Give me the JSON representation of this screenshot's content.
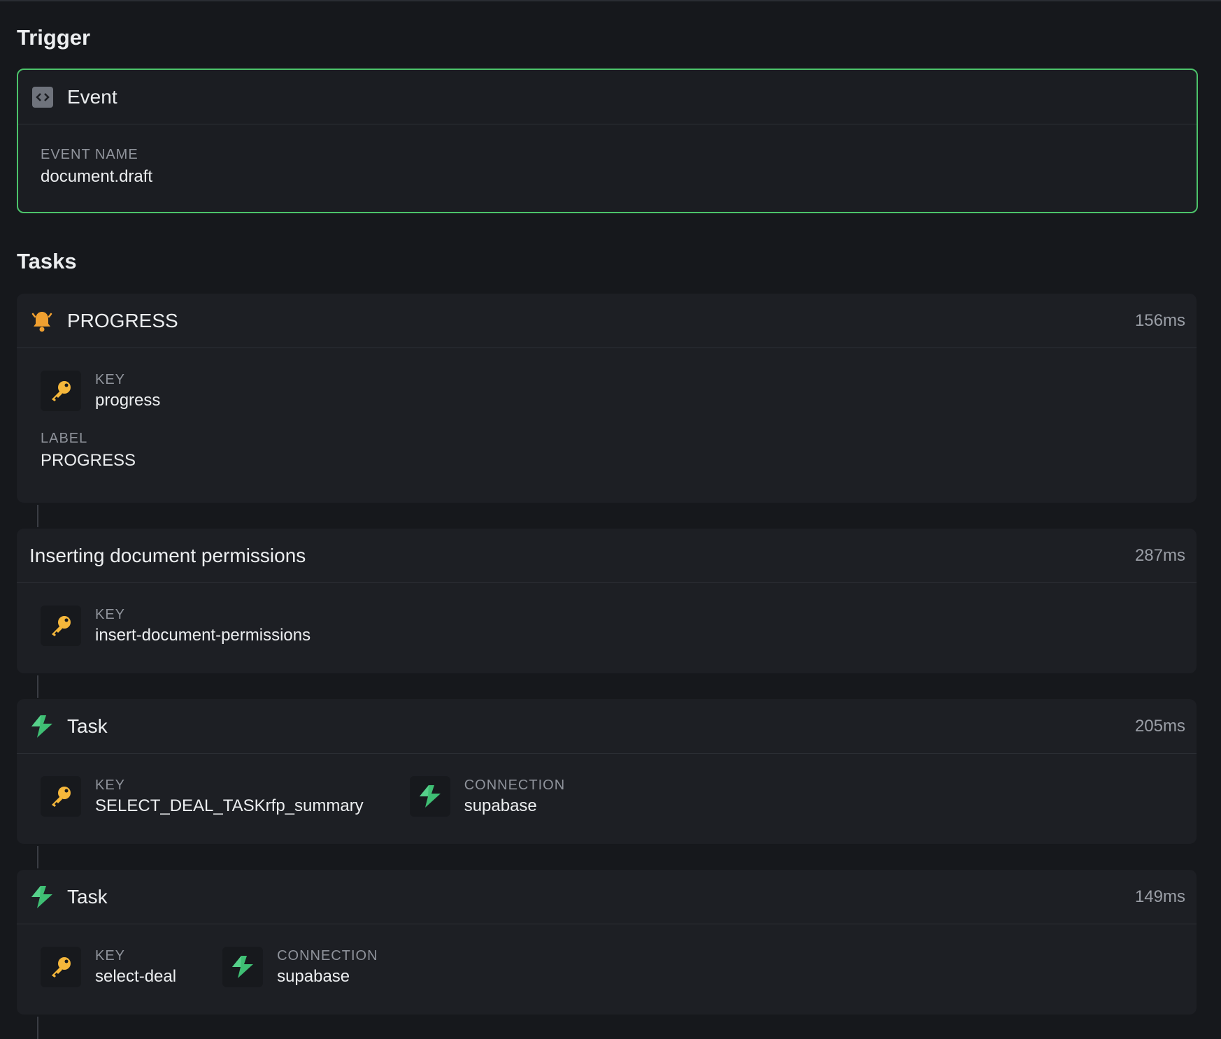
{
  "trigger": {
    "section_title": "Trigger",
    "card_title": "Event",
    "event_name_label": "EVENT NAME",
    "event_name_value": "document.draft"
  },
  "tasks_section": {
    "section_title": "Tasks"
  },
  "tasks": [
    {
      "title": "PROGRESS",
      "duration": "156ms",
      "icon": "bell-icon",
      "key_label": "KEY",
      "key_value": "progress",
      "label_label": "LABEL",
      "label_value": "PROGRESS"
    },
    {
      "title": "Inserting document permissions",
      "duration": "287ms",
      "key_label": "KEY",
      "key_value": "insert-document-permissions"
    },
    {
      "title": "Task",
      "duration": "205ms",
      "icon": "lightning-icon",
      "key_label": "KEY",
      "key_value": "SELECT_DEAL_TASKrfp_summary",
      "connection_label": "CONNECTION",
      "connection_value": "supabase"
    },
    {
      "title": "Task",
      "duration": "149ms",
      "icon": "lightning-icon",
      "key_label": "KEY",
      "key_value": "select-deal",
      "connection_label": "CONNECTION",
      "connection_value": "supabase"
    }
  ],
  "colors": {
    "background": "#16181c",
    "card": "#1d1f24",
    "trigger_border": "#4cc36a",
    "bell": "#f0a030",
    "key": "#f5b73b",
    "lightning": "#3fbf74"
  }
}
